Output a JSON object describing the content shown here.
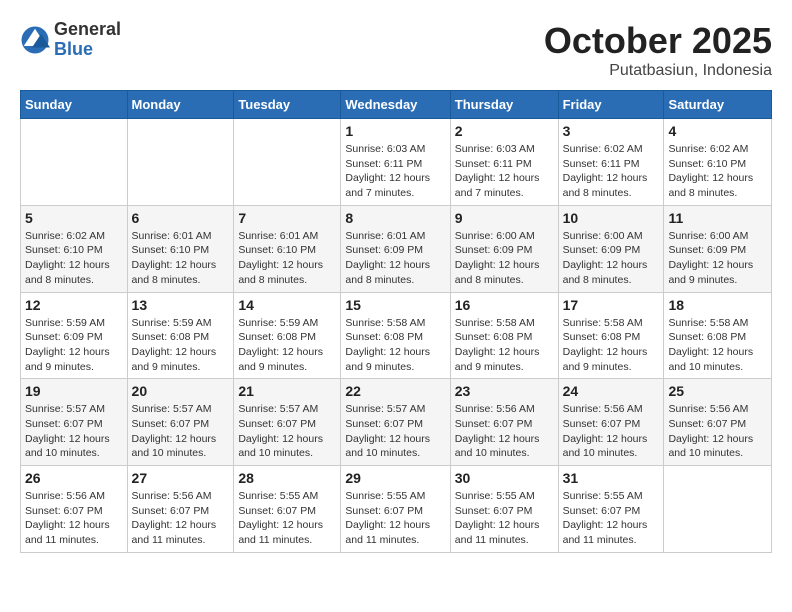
{
  "header": {
    "logo_general": "General",
    "logo_blue": "Blue",
    "month_title": "October 2025",
    "subtitle": "Putatbasiun, Indonesia"
  },
  "weekdays": [
    "Sunday",
    "Monday",
    "Tuesday",
    "Wednesday",
    "Thursday",
    "Friday",
    "Saturday"
  ],
  "weeks": [
    [
      {
        "day": "",
        "info": ""
      },
      {
        "day": "",
        "info": ""
      },
      {
        "day": "",
        "info": ""
      },
      {
        "day": "1",
        "info": "Sunrise: 6:03 AM\nSunset: 6:11 PM\nDaylight: 12 hours\nand 7 minutes."
      },
      {
        "day": "2",
        "info": "Sunrise: 6:03 AM\nSunset: 6:11 PM\nDaylight: 12 hours\nand 7 minutes."
      },
      {
        "day": "3",
        "info": "Sunrise: 6:02 AM\nSunset: 6:11 PM\nDaylight: 12 hours\nand 8 minutes."
      },
      {
        "day": "4",
        "info": "Sunrise: 6:02 AM\nSunset: 6:10 PM\nDaylight: 12 hours\nand 8 minutes."
      }
    ],
    [
      {
        "day": "5",
        "info": "Sunrise: 6:02 AM\nSunset: 6:10 PM\nDaylight: 12 hours\nand 8 minutes."
      },
      {
        "day": "6",
        "info": "Sunrise: 6:01 AM\nSunset: 6:10 PM\nDaylight: 12 hours\nand 8 minutes."
      },
      {
        "day": "7",
        "info": "Sunrise: 6:01 AM\nSunset: 6:10 PM\nDaylight: 12 hours\nand 8 minutes."
      },
      {
        "day": "8",
        "info": "Sunrise: 6:01 AM\nSunset: 6:09 PM\nDaylight: 12 hours\nand 8 minutes."
      },
      {
        "day": "9",
        "info": "Sunrise: 6:00 AM\nSunset: 6:09 PM\nDaylight: 12 hours\nand 8 minutes."
      },
      {
        "day": "10",
        "info": "Sunrise: 6:00 AM\nSunset: 6:09 PM\nDaylight: 12 hours\nand 8 minutes."
      },
      {
        "day": "11",
        "info": "Sunrise: 6:00 AM\nSunset: 6:09 PM\nDaylight: 12 hours\nand 9 minutes."
      }
    ],
    [
      {
        "day": "12",
        "info": "Sunrise: 5:59 AM\nSunset: 6:09 PM\nDaylight: 12 hours\nand 9 minutes."
      },
      {
        "day": "13",
        "info": "Sunrise: 5:59 AM\nSunset: 6:08 PM\nDaylight: 12 hours\nand 9 minutes."
      },
      {
        "day": "14",
        "info": "Sunrise: 5:59 AM\nSunset: 6:08 PM\nDaylight: 12 hours\nand 9 minutes."
      },
      {
        "day": "15",
        "info": "Sunrise: 5:58 AM\nSunset: 6:08 PM\nDaylight: 12 hours\nand 9 minutes."
      },
      {
        "day": "16",
        "info": "Sunrise: 5:58 AM\nSunset: 6:08 PM\nDaylight: 12 hours\nand 9 minutes."
      },
      {
        "day": "17",
        "info": "Sunrise: 5:58 AM\nSunset: 6:08 PM\nDaylight: 12 hours\nand 9 minutes."
      },
      {
        "day": "18",
        "info": "Sunrise: 5:58 AM\nSunset: 6:08 PM\nDaylight: 12 hours\nand 10 minutes."
      }
    ],
    [
      {
        "day": "19",
        "info": "Sunrise: 5:57 AM\nSunset: 6:07 PM\nDaylight: 12 hours\nand 10 minutes."
      },
      {
        "day": "20",
        "info": "Sunrise: 5:57 AM\nSunset: 6:07 PM\nDaylight: 12 hours\nand 10 minutes."
      },
      {
        "day": "21",
        "info": "Sunrise: 5:57 AM\nSunset: 6:07 PM\nDaylight: 12 hours\nand 10 minutes."
      },
      {
        "day": "22",
        "info": "Sunrise: 5:57 AM\nSunset: 6:07 PM\nDaylight: 12 hours\nand 10 minutes."
      },
      {
        "day": "23",
        "info": "Sunrise: 5:56 AM\nSunset: 6:07 PM\nDaylight: 12 hours\nand 10 minutes."
      },
      {
        "day": "24",
        "info": "Sunrise: 5:56 AM\nSunset: 6:07 PM\nDaylight: 12 hours\nand 10 minutes."
      },
      {
        "day": "25",
        "info": "Sunrise: 5:56 AM\nSunset: 6:07 PM\nDaylight: 12 hours\nand 10 minutes."
      }
    ],
    [
      {
        "day": "26",
        "info": "Sunrise: 5:56 AM\nSunset: 6:07 PM\nDaylight: 12 hours\nand 11 minutes."
      },
      {
        "day": "27",
        "info": "Sunrise: 5:56 AM\nSunset: 6:07 PM\nDaylight: 12 hours\nand 11 minutes."
      },
      {
        "day": "28",
        "info": "Sunrise: 5:55 AM\nSunset: 6:07 PM\nDaylight: 12 hours\nand 11 minutes."
      },
      {
        "day": "29",
        "info": "Sunrise: 5:55 AM\nSunset: 6:07 PM\nDaylight: 12 hours\nand 11 minutes."
      },
      {
        "day": "30",
        "info": "Sunrise: 5:55 AM\nSunset: 6:07 PM\nDaylight: 12 hours\nand 11 minutes."
      },
      {
        "day": "31",
        "info": "Sunrise: 5:55 AM\nSunset: 6:07 PM\nDaylight: 12 hours\nand 11 minutes."
      },
      {
        "day": "",
        "info": ""
      }
    ]
  ]
}
